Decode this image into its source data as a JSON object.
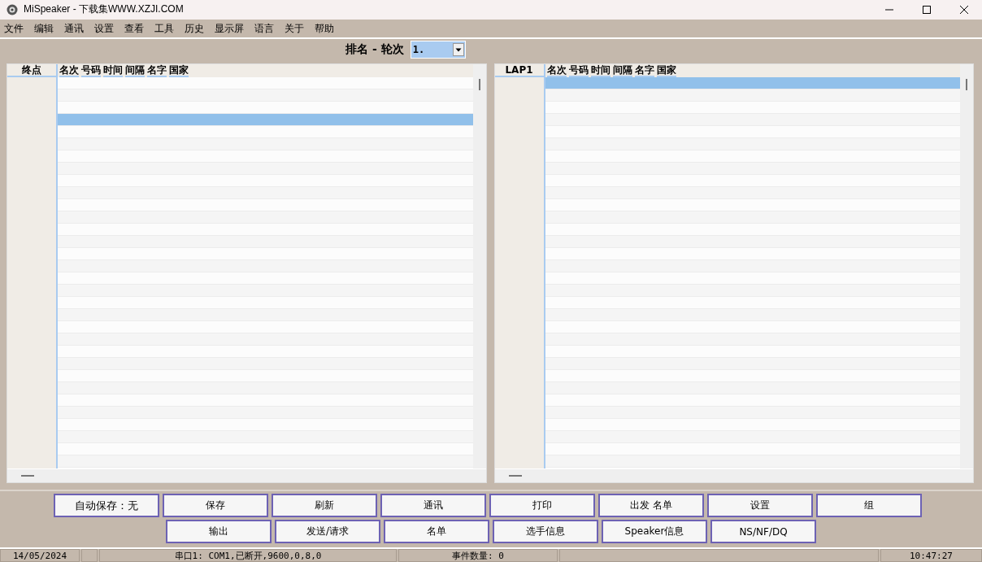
{
  "window": {
    "title": "MiSpeaker - 下载集WWW.XZJI.COM"
  },
  "menu": [
    "文件",
    "编辑",
    "通讯",
    "设置",
    "查看",
    "工具",
    "历史",
    "显示屏",
    "语言",
    "关于",
    "帮助"
  ],
  "round_selector": {
    "label": "排名 - 轮次",
    "value": "1."
  },
  "panels": [
    {
      "gutter_heading": "终点",
      "columns": [
        "名次",
        "号码",
        "时间",
        "间隔",
        "名字",
        "国家"
      ],
      "rows": [
        {
          "selected": false
        },
        {
          "selected": false
        },
        {
          "selected": false
        },
        {
          "selected": true
        },
        {
          "selected": false
        },
        {
          "selected": false
        },
        {
          "selected": false
        },
        {
          "selected": false
        },
        {
          "selected": false
        },
        {
          "selected": false
        },
        {
          "selected": false
        },
        {
          "selected": false
        },
        {
          "selected": false
        },
        {
          "selected": false
        },
        {
          "selected": false
        },
        {
          "selected": false
        },
        {
          "selected": false
        },
        {
          "selected": false
        },
        {
          "selected": false
        },
        {
          "selected": false
        },
        {
          "selected": false
        },
        {
          "selected": false
        },
        {
          "selected": false
        },
        {
          "selected": false
        },
        {
          "selected": false
        },
        {
          "selected": false
        },
        {
          "selected": false
        },
        {
          "selected": false
        },
        {
          "selected": false
        },
        {
          "selected": false
        },
        {
          "selected": false
        },
        {
          "selected": false
        }
      ]
    },
    {
      "gutter_heading": "LAP1",
      "columns": [
        "名次",
        "号码",
        "时间",
        "间隔",
        "名字",
        "国家"
      ],
      "rows": [
        {
          "selected": true
        },
        {
          "selected": false
        },
        {
          "selected": false
        },
        {
          "selected": false
        },
        {
          "selected": false
        },
        {
          "selected": false
        },
        {
          "selected": false
        },
        {
          "selected": false
        },
        {
          "selected": false
        },
        {
          "selected": false
        },
        {
          "selected": false
        },
        {
          "selected": false
        },
        {
          "selected": false
        },
        {
          "selected": false
        },
        {
          "selected": false
        },
        {
          "selected": false
        },
        {
          "selected": false
        },
        {
          "selected": false
        },
        {
          "selected": false
        },
        {
          "selected": false
        },
        {
          "selected": false
        },
        {
          "selected": false
        },
        {
          "selected": false
        },
        {
          "selected": false
        },
        {
          "selected": false
        },
        {
          "selected": false
        },
        {
          "selected": false
        },
        {
          "selected": false
        },
        {
          "selected": false
        },
        {
          "selected": false
        },
        {
          "selected": false
        },
        {
          "selected": false
        }
      ]
    }
  ],
  "button_rows": [
    {
      "status_label": "自动保存：无",
      "buttons": [
        "保存",
        "刷新",
        "通讯",
        "打印",
        "出发 名单",
        "设置",
        "组"
      ]
    },
    {
      "buttons": [
        "输出",
        "发送/请求",
        "名单",
        "选手信息",
        "Speaker信息",
        "NS/NF/DQ"
      ]
    }
  ],
  "status_bar": [
    "14/05/2024",
    "串口1: COM1,已断开,9600,0,8,0",
    "事件数量: 0",
    "10:47:27"
  ]
}
